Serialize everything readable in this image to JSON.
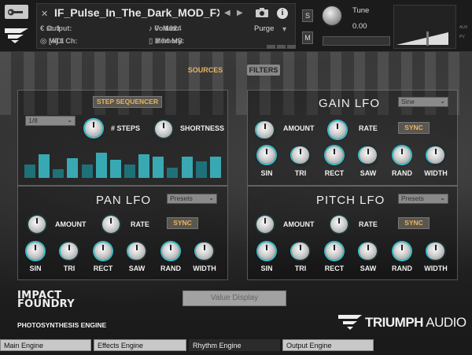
{
  "header": {
    "instrument_name": "IF_Pulse_In_The_Dark_MOD_FX_M",
    "output_label": "Output:",
    "output_value": "st. 1",
    "voices_label": "Voices:",
    "voices_value": "0",
    "max_label": "Max:",
    "max_value": "1024",
    "purge_label": "Purge",
    "midi_label": "MIDI Ch:",
    "midi_value": "[A] 1",
    "memory_label": "Memory:",
    "memory_value": "2.34 MB",
    "solo_label": "S",
    "mute_label": "M",
    "tune_label": "Tune",
    "tune_value": "0.00",
    "aux_label": "AUX",
    "pv_label": "PV",
    "info_label": "i"
  },
  "tabs": {
    "sources": "SOURCES",
    "filters": "FILTERS"
  },
  "sequencer": {
    "button": "STEP SEQUENCER",
    "rate": "1/8",
    "steps_label": "# STEPS",
    "shortness_label": "SHORTNESS",
    "steps": [
      0.45,
      0.8,
      0.3,
      0.65,
      0.45,
      0.85,
      0.6,
      0.45,
      0.8,
      0.7,
      0.35,
      0.7,
      0.55,
      0.7
    ]
  },
  "gain_lfo": {
    "title": "GAIN LFO",
    "shape": "Sine",
    "amount": "AMOUNT",
    "rate": "RATE",
    "sync": "SYNC",
    "knobs": [
      "SIN",
      "TRI",
      "RECT",
      "SAW",
      "RAND",
      "WIDTH"
    ]
  },
  "pan_lfo": {
    "title": "PAN LFO",
    "preset": "Presets",
    "amount": "AMOUNT",
    "rate": "RATE",
    "sync": "SYNC",
    "knobs": [
      "SIN",
      "TRI",
      "RECT",
      "SAW",
      "RAND",
      "WIDTH"
    ]
  },
  "pitch_lfo": {
    "title": "PITCH LFO",
    "preset": "Presets",
    "amount": "AMOUNT",
    "rate": "RATE",
    "sync": "SYNC",
    "knobs": [
      "SIN",
      "TRI",
      "RECT",
      "SAW",
      "RAND",
      "WIDTH"
    ]
  },
  "footer": {
    "logo_line1": "IMPACT",
    "logo_line2": "FOUNDRY",
    "engine_name": "PHOTOSYNTHESIS ENGINE",
    "value_display": "Value Display",
    "brand_bold": "TRIUMPH",
    "brand_light": " AUDIO"
  },
  "bottom_tabs": [
    "Main Engine",
    "Effects Engine",
    "Rhythm Engine",
    "Output Engine"
  ],
  "colors": {
    "accent_gold": "#e9b45f",
    "teal": "#3bbcc8"
  }
}
